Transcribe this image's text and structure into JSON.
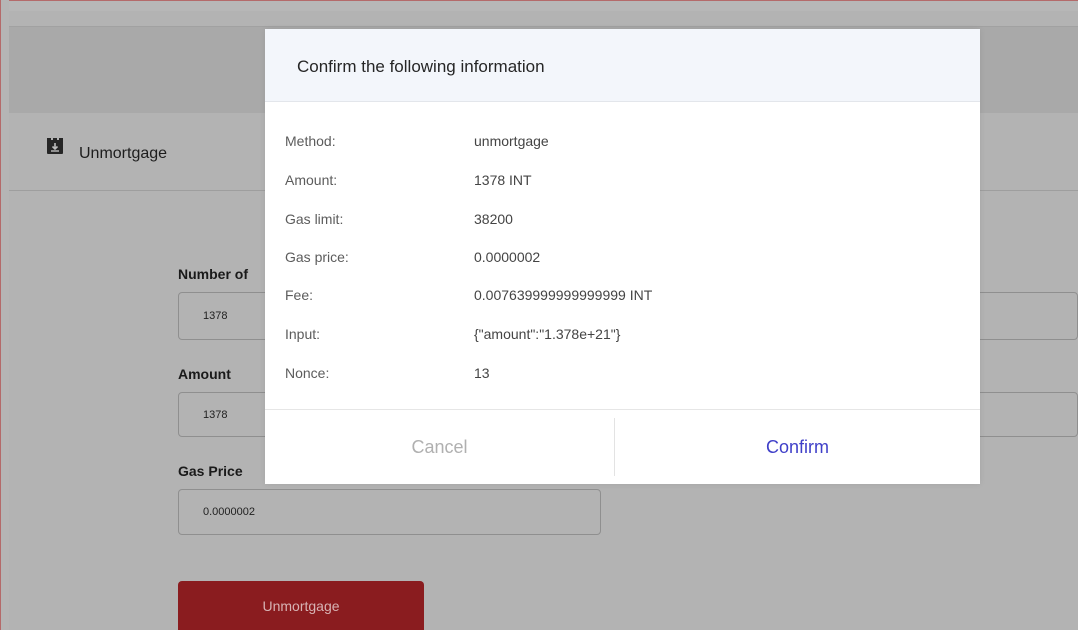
{
  "header": {
    "title": "Unmortgage",
    "icon": "unmortgage-icon"
  },
  "form": {
    "number_label": "Number of",
    "number_value": "1378",
    "amount_label": "Amount",
    "amount_value": "1378",
    "gas_price_label": "Gas Price",
    "gas_price_value": "0.0000002",
    "submit_label": "Unmortgage"
  },
  "modal": {
    "title": "Confirm the following information",
    "rows": [
      {
        "key": "Method:",
        "value": "unmortgage"
      },
      {
        "key": "Amount:",
        "value": "1378 INT"
      },
      {
        "key": "Gas limit:",
        "value": "38200"
      },
      {
        "key": "Gas price:",
        "value": "0.0000002"
      },
      {
        "key": "Fee:",
        "value": "0.007639999999999999 INT"
      },
      {
        "key": "Input:",
        "value": "{\"amount\":\"1.378e+21\"}"
      },
      {
        "key": "Nonce:",
        "value": "13"
      }
    ],
    "cancel_label": "Cancel",
    "confirm_label": "Confirm"
  },
  "colors": {
    "overlay": "#b3b3b3",
    "accent_button": "#8a1c1f",
    "confirm_text": "#3f3fc8",
    "modal_header_bg": "#f3f6fb"
  }
}
